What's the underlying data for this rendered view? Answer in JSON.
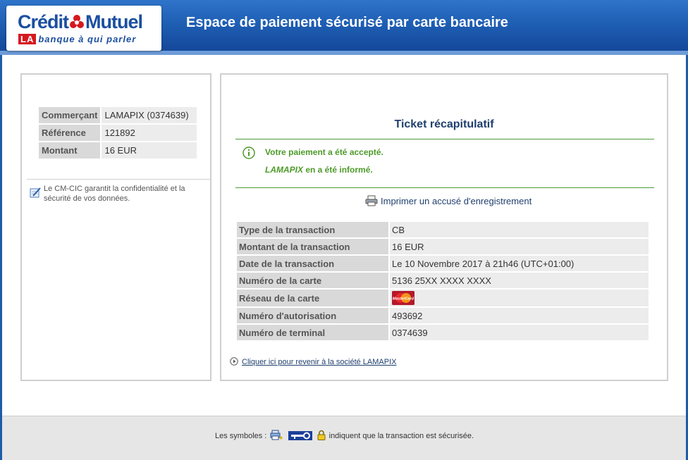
{
  "header": {
    "logo_main_left": "Crédit",
    "logo_main_right": "Mutuel",
    "logo_la": "LA",
    "logo_tagline": "banque à qui parler",
    "title": "Espace de paiement sécurisé par carte bancaire"
  },
  "merchant": {
    "rows": [
      {
        "label": "Commerçant",
        "value": "LAMAPIX (0374639)"
      },
      {
        "label": "Référence",
        "value": "121892"
      },
      {
        "label": "Montant",
        "value": "16 EUR"
      }
    ],
    "security_note": "Le CM-CIC garantit la confidentialité et la sécurité de vos données."
  },
  "ticket": {
    "title": "Ticket récapitulatif",
    "message_accepted": "Votre paiement a été accepté.",
    "merchant_name": "LAMAPIX",
    "message_informed": " en a été informé.",
    "print_label": "Imprimer un accusé d'enregistrement",
    "transaction_rows": [
      {
        "label": "Type de la transaction",
        "value": "CB"
      },
      {
        "label": "Montant de la transaction",
        "value": "16 EUR"
      },
      {
        "label": "Date de la transaction",
        "value": "Le 10 Novembre 2017 à 21h46 (UTC+01:00)"
      },
      {
        "label": "Numéro de la carte",
        "value": "5136 25XX XXXX XXXX"
      },
      {
        "label": "Réseau de la carte",
        "value": "MasterCard"
      },
      {
        "label": "Numéro d'autorisation",
        "value": "493692"
      },
      {
        "label": "Numéro de terminal",
        "value": "0374639"
      }
    ],
    "back_link": "Cliquer ici pour revenir à la société LAMAPIX"
  },
  "footer": {
    "prefix": "Les symboles :",
    "suffix": "indiquent que la transaction est sécurisée."
  },
  "colors": {
    "brand_blue": "#1b4fa0",
    "brand_red": "#d7181f",
    "success_green": "#4d9a2a"
  }
}
